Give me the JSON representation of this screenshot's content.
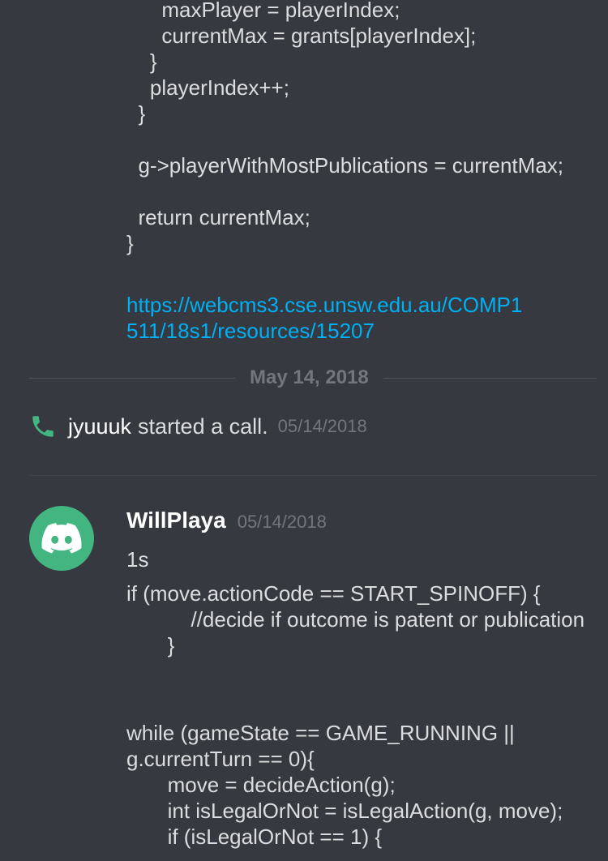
{
  "messages": {
    "prev_code": "      maxPlayer = playerIndex;\n      currentMax = grants[playerIndex];\n    }\n    playerIndex++;\n  }\n\n  g->playerWithMostPublications = currentMax;\n\n  return currentMax;\n}",
    "prev_link": "https://webcms3.cse.unsw.edu.au/COMP1511/18s1/resources/15207",
    "date_divider": "May 14, 2018",
    "call": {
      "user": "jyuuuk",
      "text": "started a call.",
      "time": "05/14/2018"
    },
    "post": {
      "username": "WillPlaya",
      "time": "05/14/2018",
      "line1": "1s",
      "code1": "if (move.actionCode == START_SPINOFF) {\n           //decide if outcome is patent or publication\n       }",
      "code2": "while (gameState == GAME_RUNNING || g.currentTurn == 0){\n       move = decideAction(g);\n       int isLegalOrNot = isLegalAction(g, move);\n       if (isLegalOrNot == 1) {"
    }
  },
  "colors": {
    "background": "#36393f",
    "link": "#00b0f4",
    "avatar": "#43b581",
    "call_icon": "#43b581"
  },
  "icons": {
    "call": "phone-icon",
    "avatar": "discord-logo-icon"
  }
}
